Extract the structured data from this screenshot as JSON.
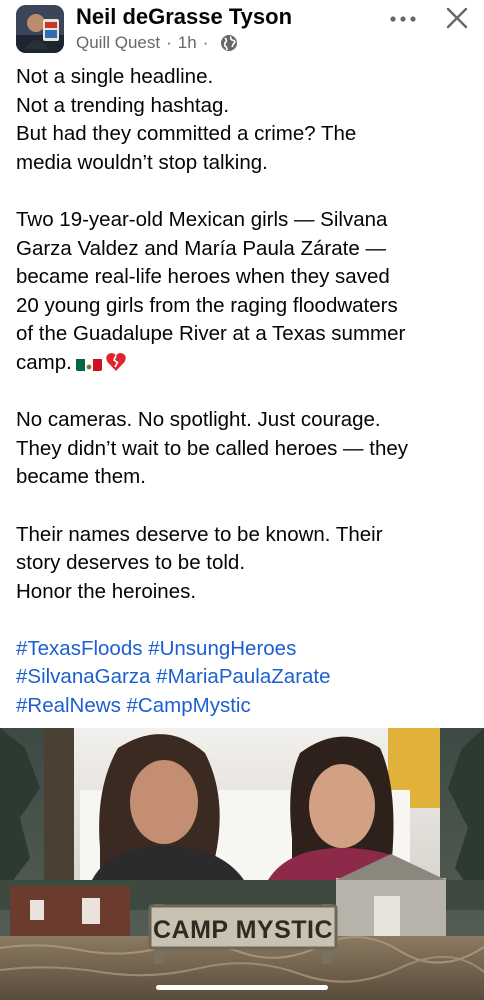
{
  "post": {
    "author": "Neil deGrasse Tyson",
    "group": "Quill Quest",
    "time": "1h",
    "separator": "·",
    "privacy_icon": "globe-icon",
    "body_lines": [
      "Not a single headline.",
      "Not a trending hashtag.",
      "But had they committed a crime? The",
      "media wouldn’t stop talking.",
      "",
      "Two 19-year-old Mexican girls — Silvana",
      "Garza Valdez and María Paula Zárate —",
      "became real-life heroes when they saved",
      "20 young girls from the raging floodwaters",
      "of the Guadalupe River at a Texas summer",
      "camp.",
      "",
      "No cameras. No spotlight. Just courage.",
      "They didn’t wait to be called heroes — they",
      "became them.",
      "",
      "Their names deserve to be known. Their",
      "story deserves to be told.",
      "Honor the heroines."
    ],
    "emoji_after_camp": [
      "mexico-flag-icon",
      "broken-heart-icon"
    ],
    "hashtag_lines": [
      [
        "#TexasFloods",
        "#UnsungHeroes"
      ],
      [
        "#SilvanaGarza",
        "#MariaPaulaZarate"
      ],
      [
        "#RealNews",
        "#CampMystic"
      ]
    ],
    "image": {
      "sign_text": "CAMP MYSTIC"
    }
  },
  "colors": {
    "text": "#050505",
    "meta": "#65676b",
    "hashtag": "#1d5fd1",
    "background": "#ffffff"
  }
}
